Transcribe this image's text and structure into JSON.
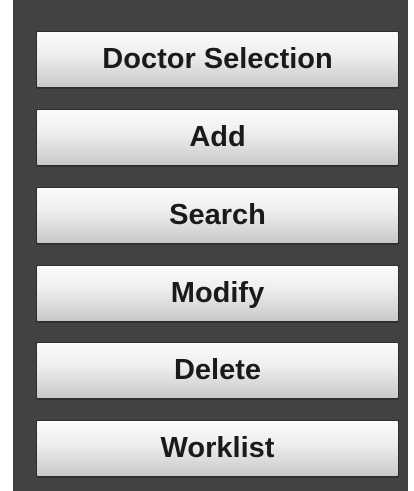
{
  "menu": {
    "items": [
      {
        "label": "Doctor Selection"
      },
      {
        "label": "Add"
      },
      {
        "label": "Search"
      },
      {
        "label": "Modify"
      },
      {
        "label": "Delete"
      },
      {
        "label": "Worklist"
      }
    ]
  },
  "colors": {
    "panel_background": "#424242",
    "button_text": "#1a1a1a",
    "button_light": "#fbfbfb",
    "button_dark": "#c8c8c8"
  }
}
